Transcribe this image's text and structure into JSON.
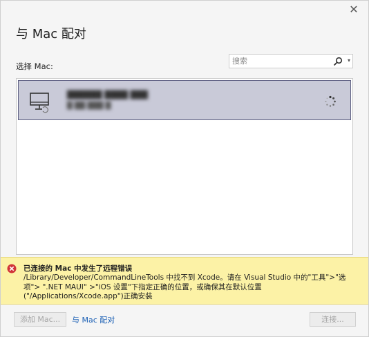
{
  "dialog": {
    "title": "与 Mac 配对",
    "close_glyph": "✕"
  },
  "select_label": "选择 Mac:",
  "search": {
    "placeholder": "搜索",
    "icon": "search-icon"
  },
  "mac_list": {
    "items": [
      {
        "name": "██████ ████ ███",
        "detail": "█ ██ ███ █",
        "icon": "mac-computer-icon",
        "status_icon": "loading-spinner-icon"
      }
    ]
  },
  "error": {
    "icon": "error-circle-icon",
    "title": "已连接的 Mac 中发生了远程错误",
    "message": "/Library/Developer/CommandLineTools 中找不到 Xcode。请在 Visual Studio 中的\"工具\">\"选项\"> \".NET MAUI\" >\"iOS 设置\"下指定正确的位置，或确保其在默认位置(\"/Applications/Xcode.app\")正确安装"
  },
  "footer": {
    "add_mac_label": "添加 Mac...",
    "pair_link_label": "与 Mac 配对",
    "connect_label": "连接..."
  },
  "colors": {
    "selection_bg": "#c9cad8",
    "selection_border": "#5d5f82",
    "error_bg": "#fcf2a6",
    "error_icon": "#d13438",
    "link": "#1a5fb4"
  }
}
